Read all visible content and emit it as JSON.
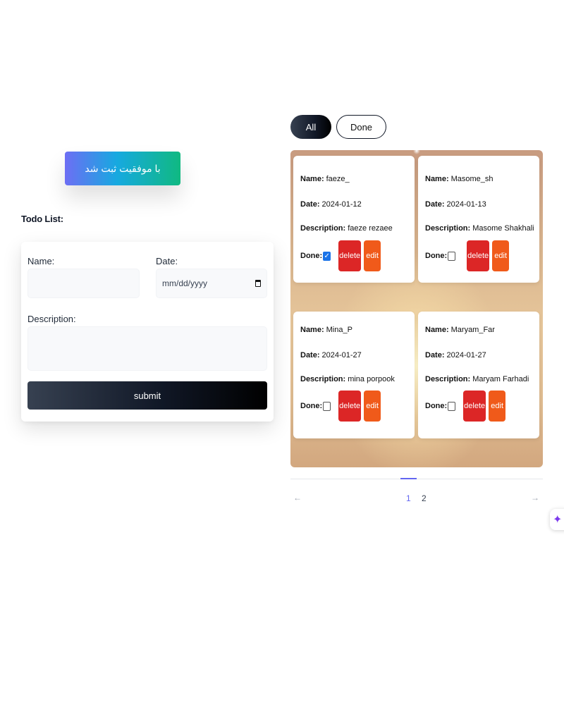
{
  "toast": {
    "message": "با موفقیت ثبت شد"
  },
  "form": {
    "section_title": "Todo List:",
    "name_label": "Name:",
    "name_value": "",
    "date_label": "Date:",
    "date_placeholder": "mm/dd/yyyy",
    "description_label": "Description:",
    "description_value": "",
    "submit_label": "submit"
  },
  "filters": {
    "all_label": "All",
    "done_label": "Done",
    "active": "All"
  },
  "card_labels": {
    "name": "Name:",
    "date": "Date:",
    "description": "Description:",
    "done": "Done:",
    "delete": "delete",
    "edit": "edit"
  },
  "todos": [
    {
      "name": "faeze_",
      "date": "2024-01-12",
      "description": "faeze rezaee",
      "done": true
    },
    {
      "name": "Masome_sh",
      "date": "2024-01-13",
      "description": "Masome Shakhali",
      "done": false
    },
    {
      "name": "Mina_P",
      "date": "2024-01-27",
      "description": "mina porpook",
      "done": false
    },
    {
      "name": "Maryam_Far",
      "date": "2024-01-27",
      "description": "Maryam Farhadi",
      "done": false
    }
  ],
  "pagination": {
    "prev_arrow": "←",
    "next_arrow": "→",
    "pages": [
      "1",
      "2"
    ],
    "current": "1"
  },
  "colors": {
    "delete": "#dc2626",
    "edit": "#f05a1a",
    "accent": "#6366f1",
    "checkbox_checked": "#1a73e8"
  },
  "fab": {
    "icon": "sparkle-icon",
    "glyph": "✦"
  }
}
